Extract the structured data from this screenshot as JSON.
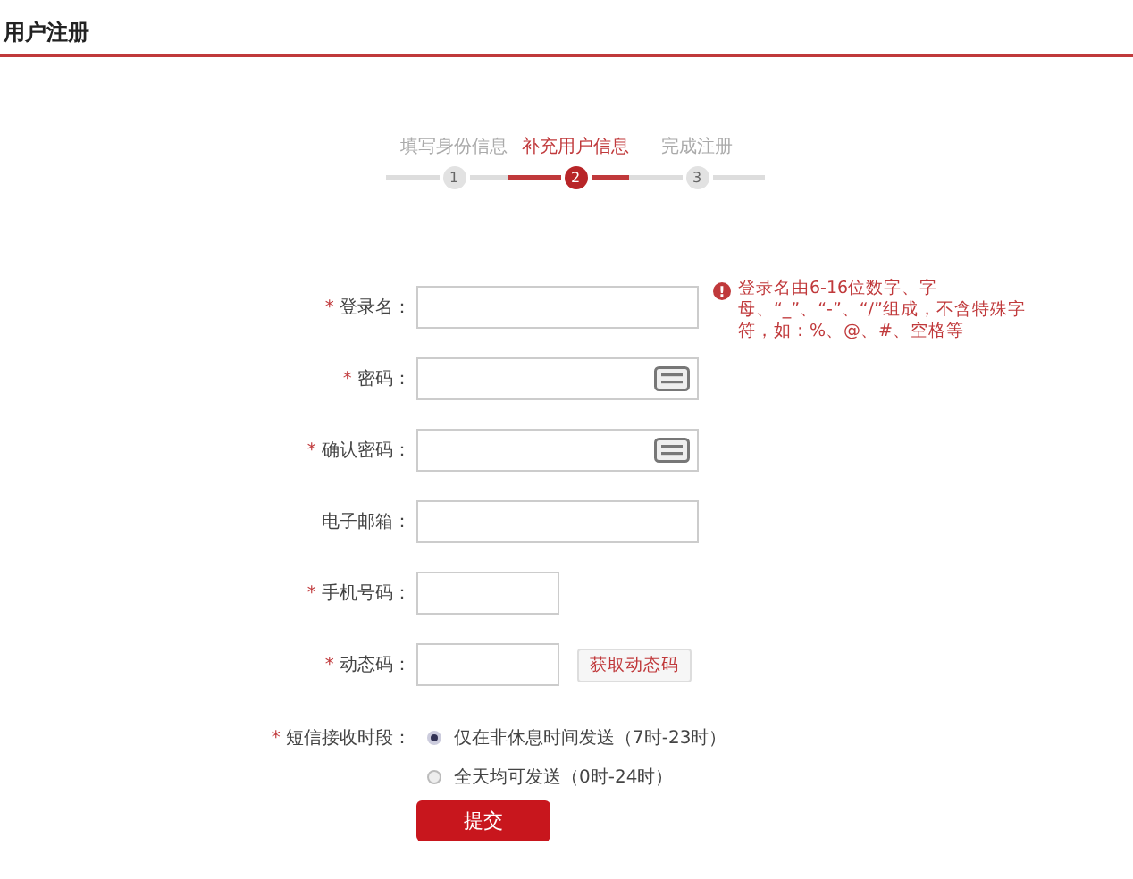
{
  "title": "用户注册",
  "steps": [
    {
      "label": "填写身份信息",
      "number": "1",
      "selected": false
    },
    {
      "label": "补充用户信息",
      "number": "2",
      "selected": true
    },
    {
      "label": "完成注册",
      "number": "3",
      "selected": false
    }
  ],
  "fields": [
    {
      "kind": "long",
      "mark": "*",
      "label": "登录名：",
      "hint": "登录名由6-16位数字、字母、“_”、“-”、“/”组成，不含特殊字符，如：%、@、#、空格等",
      "hint_icon": "!"
    },
    {
      "kind": "password",
      "mark": "*",
      "label": "密码："
    },
    {
      "kind": "password",
      "mark": "*",
      "label": "确认密码："
    },
    {
      "kind": "long",
      "label": "电子邮箱："
    },
    {
      "kind": "short",
      "mark": "*",
      "label": "手机号码："
    },
    {
      "kind": "code",
      "mark": "*",
      "label": "动态码：",
      "button": "获取动态码"
    }
  ],
  "sms": {
    "mark": "*",
    "label": "短信接收时段：",
    "options": [
      {
        "label": "仅在非休息时间发送（7时-23时）",
        "selected": true
      },
      {
        "label": "全天均可发送（0时-24时）",
        "selected": false
      }
    ]
  },
  "submit": "提交"
}
